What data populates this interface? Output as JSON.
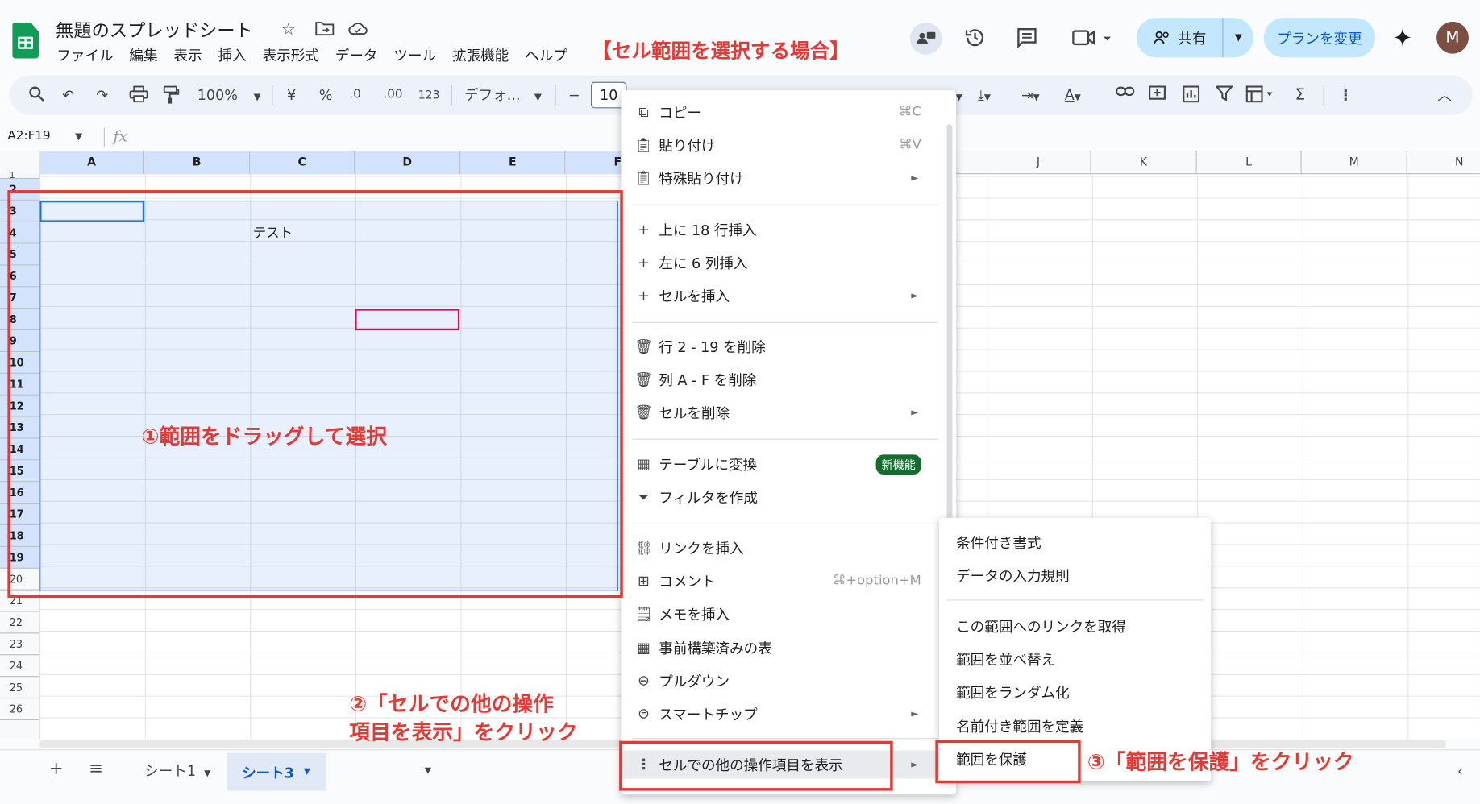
{
  "header": {
    "doc_title": "無題のスプレッドシート",
    "menus": [
      "ファイル",
      "編集",
      "表示",
      "挿入",
      "表示形式",
      "データ",
      "ツール",
      "拡張機能",
      "ヘルプ"
    ],
    "share_label": "共有",
    "plan_label": "プランを変更",
    "avatar_initial": "M"
  },
  "annotation_title": "【セル範囲を選択する場合】",
  "toolbar": {
    "zoom": "100%",
    "currency": "¥",
    "percent": "%",
    "dec_minus": ".0",
    "dec_plus": ".00",
    "format_123": "123",
    "font": "デフォ...",
    "font_size": "10"
  },
  "formula_bar": {
    "name_box": "A2:F19",
    "fx": "fx"
  },
  "grid": {
    "columns": [
      "A",
      "B",
      "C",
      "D",
      "E",
      "F",
      "J",
      "K",
      "L",
      "M",
      "N"
    ],
    "rows": [
      "1",
      "2",
      "3",
      "4",
      "5",
      "6",
      "7",
      "8",
      "9",
      "10",
      "11",
      "12",
      "13",
      "14",
      "15",
      "16",
      "17",
      "18",
      "19",
      "20",
      "21",
      "22",
      "23",
      "24",
      "25",
      "26"
    ],
    "cell_c3": "テスト"
  },
  "context_menu": {
    "items": [
      {
        "label": "コピー",
        "shortcut": "⌘C",
        "icon": "copy-icon"
      },
      {
        "label": "貼り付け",
        "shortcut": "⌘V",
        "icon": "paste-icon"
      },
      {
        "label": "特殊貼り付け",
        "icon": "paste-special-icon"
      },
      {
        "label": "上に 18 行挿入",
        "icon": "plus-icon"
      },
      {
        "label": "左に 6 列挿入",
        "icon": "plus-icon"
      },
      {
        "label": "セルを挿入",
        "icon": "plus-icon"
      },
      {
        "label": "行 2 - 19 を削除",
        "icon": "trash-icon"
      },
      {
        "label": "列 A - F を削除",
        "icon": "trash-icon"
      },
      {
        "label": "セルを削除",
        "icon": "trash-icon"
      },
      {
        "label": "テーブルに変換",
        "badge": "新機能",
        "icon": "table-icon"
      },
      {
        "label": "フィルタを作成",
        "icon": "filter-icon"
      },
      {
        "label": "リンクを挿入",
        "icon": "link-icon"
      },
      {
        "label": "コメント",
        "shortcut": "⌘+option+M",
        "icon": "comment-icon"
      },
      {
        "label": "メモを挿入",
        "icon": "note-icon"
      },
      {
        "label": "事前構築済みの表",
        "icon": "table-icon"
      },
      {
        "label": "プルダウン",
        "icon": "dropdown-icon"
      },
      {
        "label": "スマートチップ",
        "icon": "chip-icon"
      },
      {
        "label": "セルでの他の操作項目を表示",
        "icon": "more-vert-icon"
      }
    ]
  },
  "submenu": {
    "items": [
      "条件付き書式",
      "データの入力規則",
      "この範囲へのリンクを取得",
      "範囲を並べ替え",
      "範囲をランダム化",
      "名前付き範囲を定義",
      "範囲を保護"
    ]
  },
  "annotations": {
    "step1": "①範囲をドラッグして選択",
    "step2_line1": "②「セルでの他の操作",
    "step2_line2": "項目を表示」をクリック",
    "step3": "③「範囲を保護」をクリック"
  },
  "sheet_tabs": {
    "tab1": "シート1",
    "tab3": "シート3"
  },
  "colors": {
    "accent_red": "#e53935",
    "selection_blue": "#d3e3fd",
    "share_bg": "#c2e7ff",
    "new_badge": "#146c2e"
  }
}
